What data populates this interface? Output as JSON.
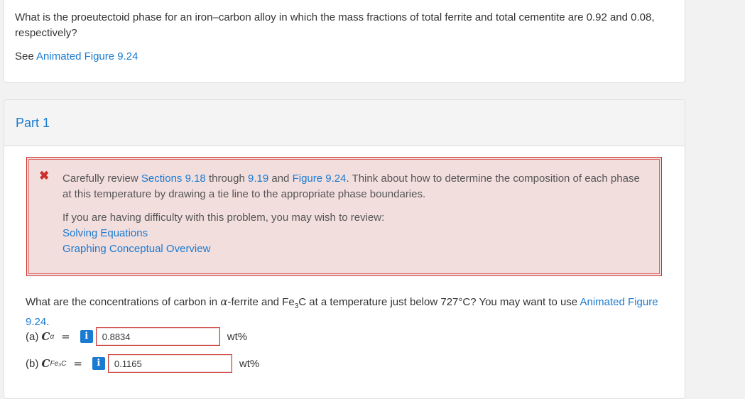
{
  "question": {
    "text": "What is the proeutectoid phase for an iron–carbon alloy in which the mass fractions of total ferrite and total cementite are 0.92 and 0.08, respectively?",
    "see_prefix": "See",
    "see_link": "Animated Figure 9.24"
  },
  "part": {
    "title": "Part 1",
    "feedback": {
      "icon": "close-icon",
      "main_prefix": "Carefully review",
      "link_sections": "Sections 9.18",
      "through": "through",
      "link_919": "9.19",
      "and": "and",
      "link_figure": "Figure 9.24",
      "main_suffix": ". Think about how to determine the composition of each phase at this temperature by drawing a tie line to the appropriate phase boundaries.",
      "review_intro": "If you are having difficulty with this problem, you may wish to review:",
      "review_links": [
        "Solving Equations",
        "Graphing Conceptual Overview"
      ]
    },
    "subquestion": {
      "prefix": "What are the concentrations of carbon in",
      "alpha": "α",
      "middle": "-ferrite and Fe",
      "sub3": "3",
      "suffix": "C at a temperature just below 727°C? You may want to use",
      "link": "Animated Figure 9.24",
      "period": "."
    },
    "answers": [
      {
        "label": "(a)",
        "symbol": "C",
        "subscript": "α",
        "equals": "=",
        "info": "i",
        "value": "0.8834",
        "unit": "wt%"
      },
      {
        "label": "(b)",
        "symbol": "C",
        "subscript": "Fe₃C",
        "equals": "=",
        "info": "i",
        "value": "0.1165",
        "unit": "wt%"
      }
    ]
  }
}
